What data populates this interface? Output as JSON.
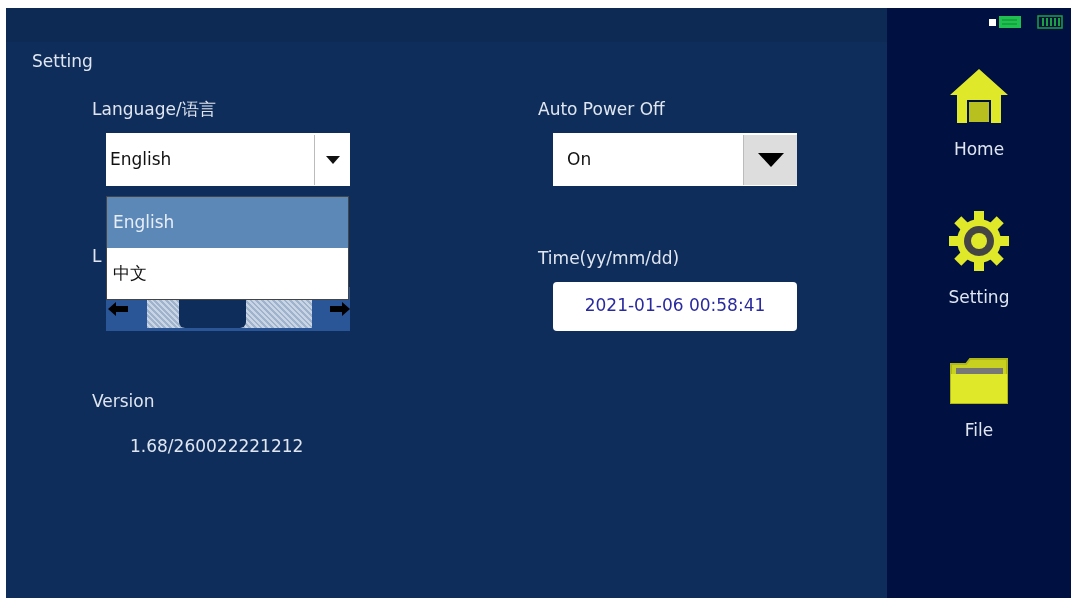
{
  "page": {
    "title": "Setting"
  },
  "language": {
    "label": "Language/语言",
    "value": "English",
    "expanded": true,
    "options": [
      {
        "label": "English",
        "selected": true
      },
      {
        "label": "中文",
        "selected": false
      }
    ]
  },
  "hidden_setting": {
    "label": "L",
    "level": 0.33
  },
  "auto_power_off": {
    "label": "Auto Power Off",
    "value": "On"
  },
  "time": {
    "label": "Time(yy/mm/dd)",
    "value": "2021-01-06 00:58:41"
  },
  "version": {
    "label": "Version",
    "value": "1.68/260022221212"
  },
  "sidebar": {
    "items": [
      {
        "kind": "home",
        "label": "Home"
      },
      {
        "kind": "setting",
        "label": "Setting"
      },
      {
        "kind": "file",
        "label": "File"
      }
    ]
  }
}
